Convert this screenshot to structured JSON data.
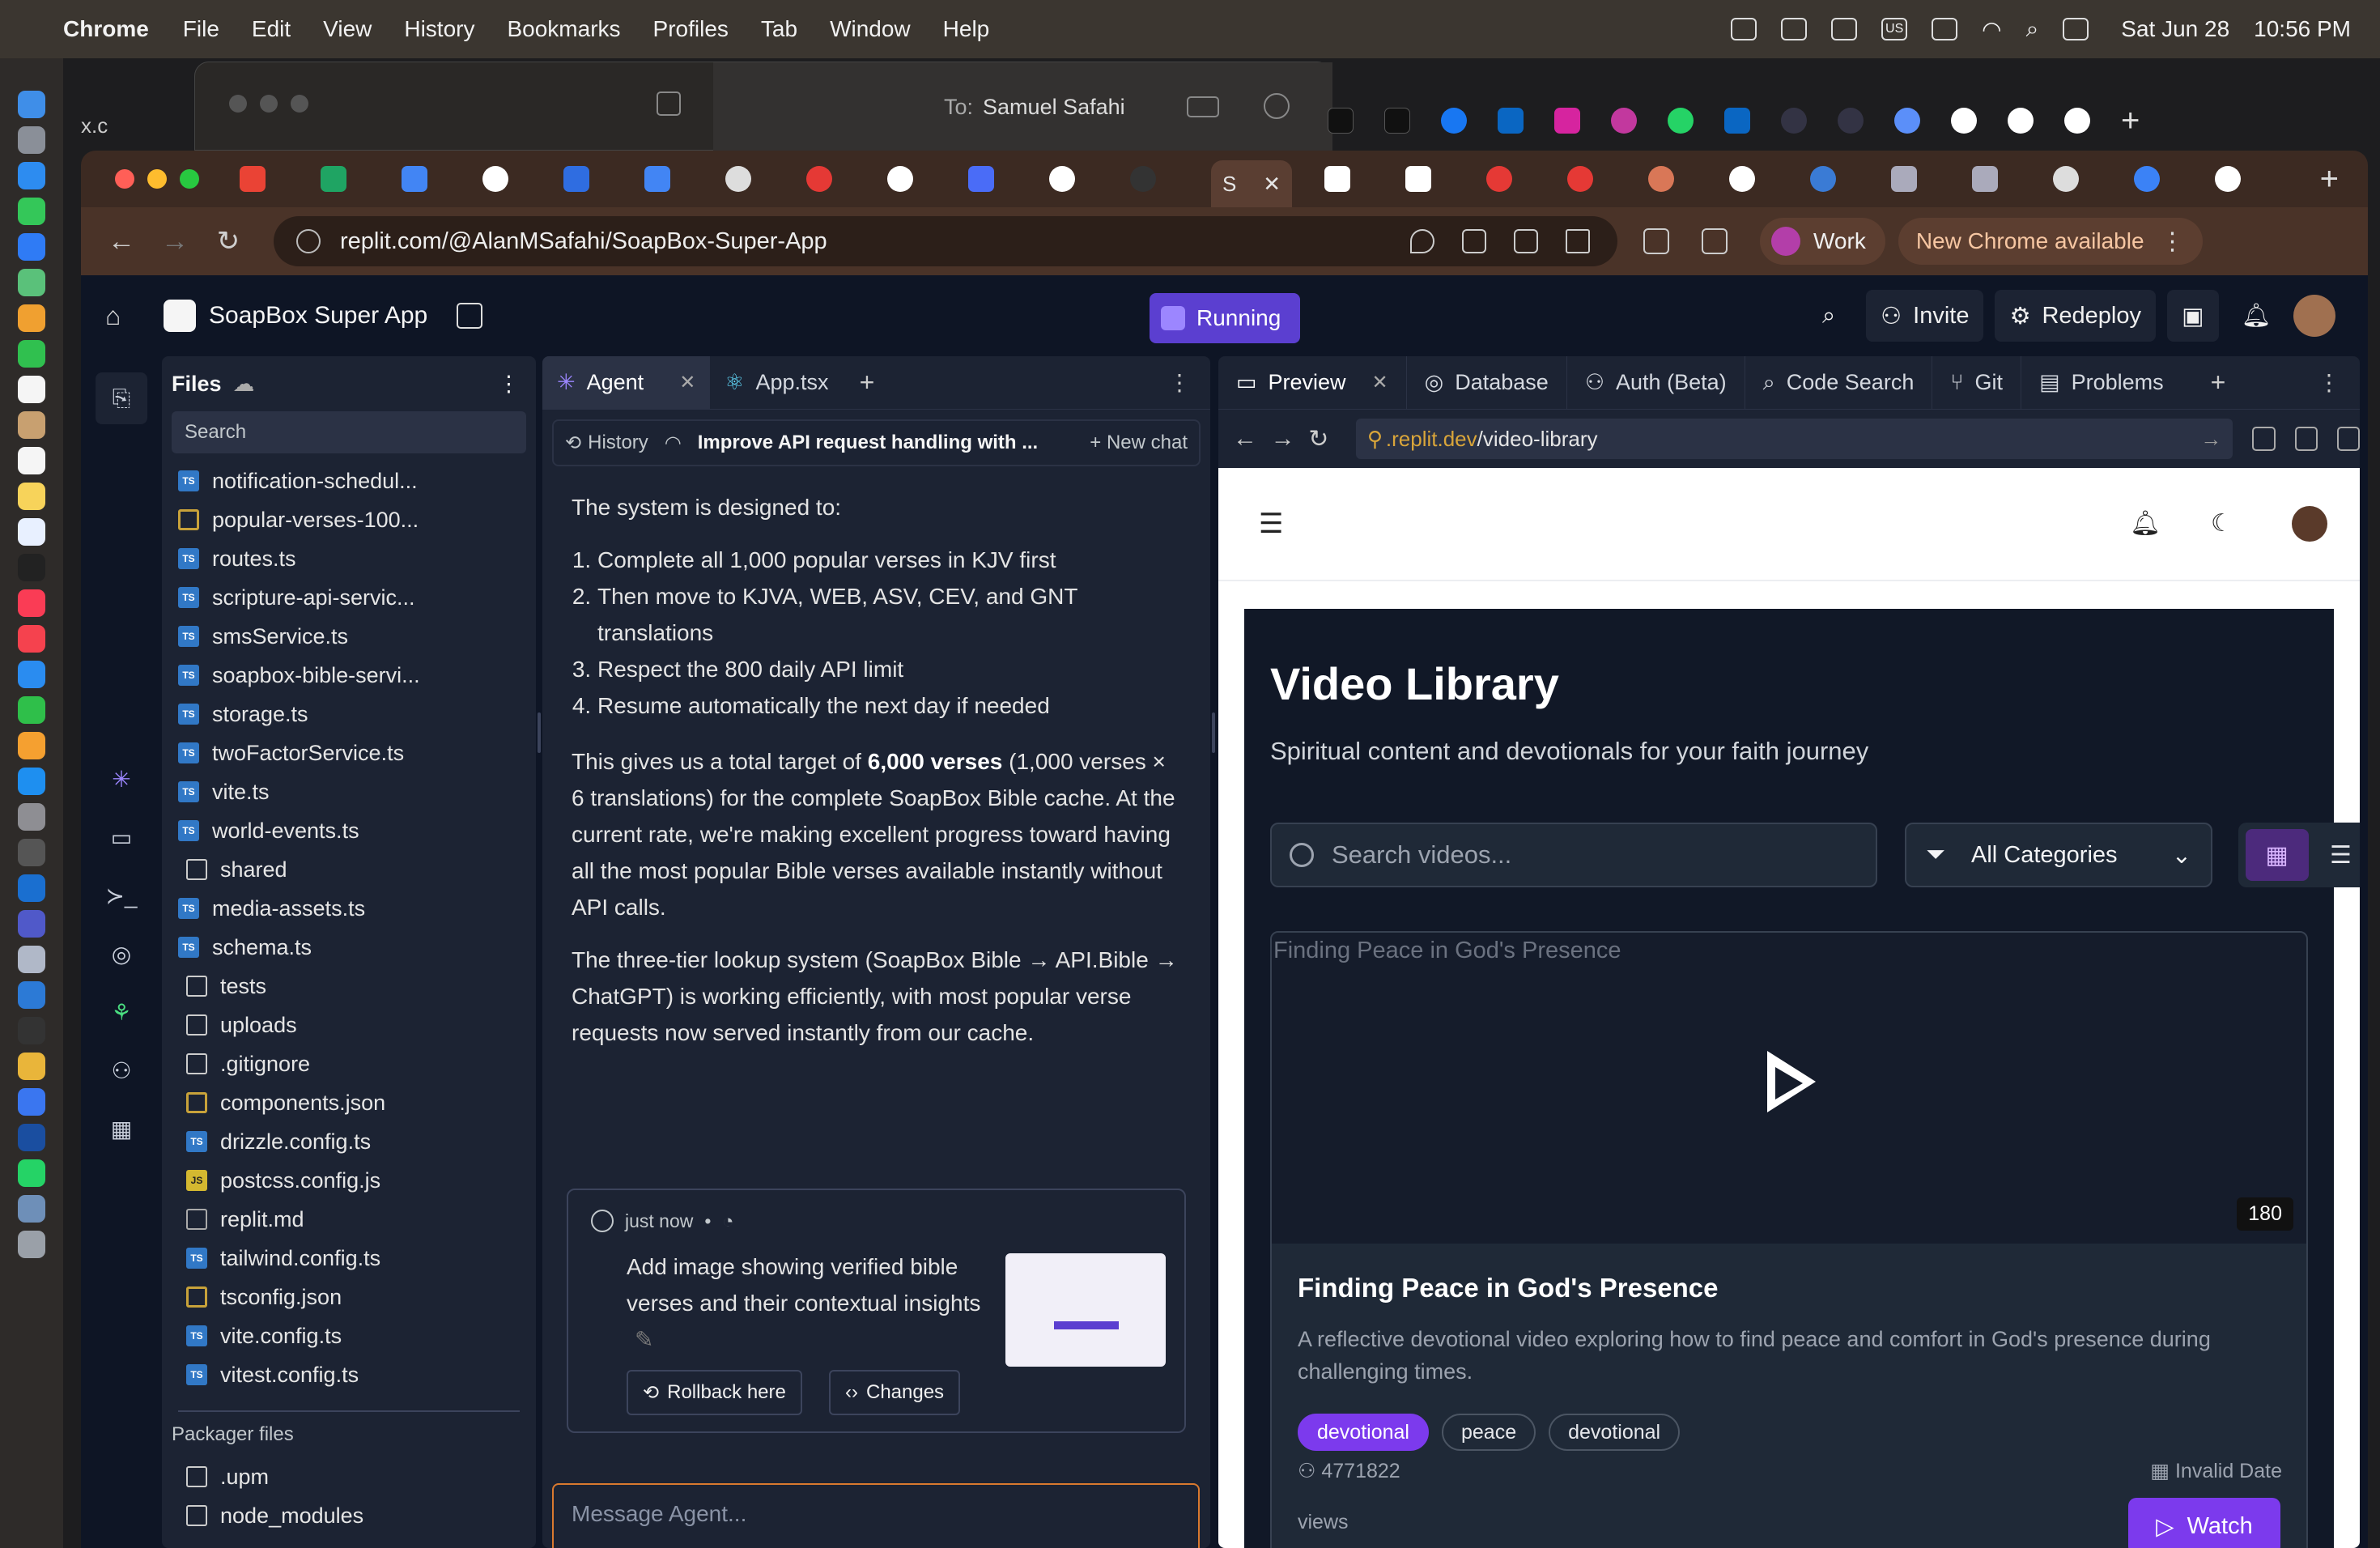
{
  "menubar": {
    "app_name": "Chrome",
    "menus": [
      "File",
      "Edit",
      "View",
      "History",
      "Bookmarks",
      "Profiles",
      "Tab",
      "Window",
      "Help"
    ],
    "date": "Sat Jun 28",
    "time": "10:56 PM",
    "keyboard": "US"
  },
  "messages_window": {
    "to_label": "To:",
    "recipient": "Samuel Safahi",
    "behind_tab": "x.c"
  },
  "browser": {
    "url": "replit.com/@AlanMSafahi/SoapBox-Super-App",
    "active_tab_label": "S",
    "profile_label": "Work",
    "update_label": "New Chrome available"
  },
  "replit": {
    "app_title": "SoapBox Super App",
    "run_status": "Running",
    "invite_label": "Invite",
    "redeploy_label": "Redeploy"
  },
  "files": {
    "title": "Files",
    "search_placeholder": "Search",
    "items": [
      {
        "name": "notification-schedul...",
        "type": "ts",
        "indent": 1
      },
      {
        "name": "popular-verses-100...",
        "type": "json",
        "indent": 1
      },
      {
        "name": "routes.ts",
        "type": "ts",
        "indent": 1
      },
      {
        "name": "scripture-api-servic...",
        "type": "ts",
        "indent": 1
      },
      {
        "name": "smsService.ts",
        "type": "ts",
        "indent": 1
      },
      {
        "name": "soapbox-bible-servi...",
        "type": "ts",
        "indent": 1
      },
      {
        "name": "storage.ts",
        "type": "ts",
        "indent": 1
      },
      {
        "name": "twoFactorService.ts",
        "type": "ts",
        "indent": 1
      },
      {
        "name": "vite.ts",
        "type": "ts",
        "indent": 1
      },
      {
        "name": "world-events.ts",
        "type": "ts",
        "indent": 1
      },
      {
        "name": "shared",
        "type": "folder",
        "indent": 0
      },
      {
        "name": "media-assets.ts",
        "type": "ts",
        "indent": 1
      },
      {
        "name": "schema.ts",
        "type": "ts",
        "indent": 1
      },
      {
        "name": "tests",
        "type": "folder",
        "indent": 0
      },
      {
        "name": "uploads",
        "type": "folder",
        "indent": 0
      },
      {
        "name": ".gitignore",
        "type": "file",
        "indent": 0
      },
      {
        "name": "components.json",
        "type": "json",
        "indent": 0
      },
      {
        "name": "drizzle.config.ts",
        "type": "ts",
        "indent": 0
      },
      {
        "name": "postcss.config.js",
        "type": "js",
        "indent": 0
      },
      {
        "name": "replit.md",
        "type": "md",
        "indent": 0
      },
      {
        "name": "tailwind.config.ts",
        "type": "ts",
        "indent": 0
      },
      {
        "name": "tsconfig.json",
        "type": "json",
        "indent": 0
      },
      {
        "name": "vite.config.ts",
        "type": "ts",
        "indent": 0
      },
      {
        "name": "vitest.config.ts",
        "type": "ts",
        "indent": 0
      }
    ],
    "packager_title": "Packager files",
    "packager_items": [
      {
        "name": ".upm",
        "type": "folder"
      },
      {
        "name": "node_modules",
        "type": "folder"
      }
    ]
  },
  "agent": {
    "tabs": [
      {
        "label": "Agent"
      },
      {
        "label": "App.tsx"
      }
    ],
    "history_label": "History",
    "chat_title": "Improve API request handling with ...",
    "new_chat_label": "New chat",
    "intro": "The system is designed to:",
    "steps": [
      "Complete all 1,000 popular verses in KJV first",
      "Then move to KJVA, WEB, ASV, CEV, and GNT translations",
      "Respect the 800 daily API limit",
      "Resume automatically the next day if needed"
    ],
    "para1_pre": "This gives us a total target of ",
    "para1_bold": "6,000 verses",
    "para1_post": " (1,000 verses × 6 translations) for the complete SoapBox Bible cache. At the current rate, we're making excellent progress toward having all the most popular Bible verses available instantly without API calls.",
    "para2": "The three-tier lookup system (SoapBox Bible → API.Bible → ChatGPT) is working efficiently, with most popular verse requests now served instantly from our cache.",
    "checkpoint": {
      "time": "just now",
      "description": "Add image showing verified bible verses and their contextual insights",
      "rollback_label": "Rollback here",
      "changes_label": "Changes"
    },
    "input_placeholder": "Message Agent..."
  },
  "preview": {
    "tabs": [
      {
        "label": "Preview"
      },
      {
        "label": "Database"
      },
      {
        "label": "Auth (Beta)"
      },
      {
        "label": "Code Search"
      },
      {
        "label": "Git"
      },
      {
        "label": "Problems"
      }
    ],
    "address_host": ".replit.dev",
    "address_path": "/video-library",
    "site": {
      "title": "Video Library",
      "subtitle": "Spiritual content and devotionals for your faith journey",
      "search_placeholder": "Search videos...",
      "category_label": "All Categories",
      "video": {
        "thumb_alt": "Finding Peace in God's Presence",
        "duration": "180",
        "title": "Finding Peace in God's Presence",
        "description": "A reflective devotional video exploring how to find peace and comfort in God's presence during challenging times.",
        "tags": [
          "devotional",
          "peace",
          "devotional"
        ],
        "views_count": "4771822",
        "views_label": "views",
        "date": "Invalid Date",
        "watch_label": "Watch"
      }
    }
  },
  "colors": {
    "replit_bg": "#0e1525",
    "panel_bg": "#1c2333",
    "accent": "#7c3aed",
    "running": "#5b3fd0",
    "input_focus": "#d9792f"
  }
}
